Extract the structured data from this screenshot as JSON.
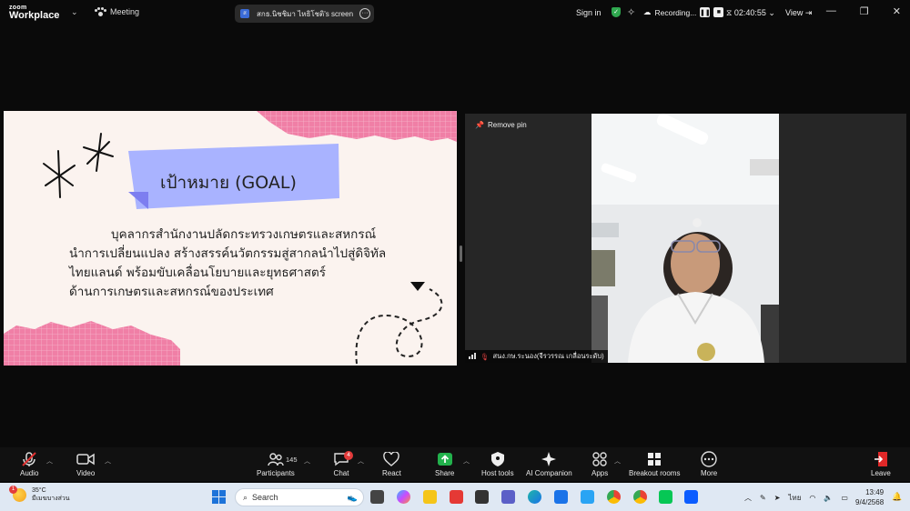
{
  "titlebar": {
    "logo_top": "zoom",
    "logo_bottom": "Workplace",
    "meeting_label": "Meeting",
    "share_pill_badge": "ส",
    "share_pill_text": "สกธ.นิชชิมา  ไหธิโชติ's screen",
    "signin": "Sign in",
    "recording": "Recording...",
    "timer": "02:40:55",
    "view": "View"
  },
  "slide": {
    "title": "เป้าหมาย (GOAL)",
    "body_lines": [
      "บุคลากรสำนักงานปลัดกระทรวงเกษตรและสหกรณ์",
      "นำการเปลี่ยนแปลง สร้างสรรค์นวัตกรรมสู่สากลนำไปสู่ดิจิทัล",
      "ไทยแลนด์ พร้อมขับเคลื่อนโยบายและยุทธศาสตร์",
      "ด้านการเกษตรและสหกรณ์ของประเทศ"
    ]
  },
  "video": {
    "remove_pin": "Remove pin",
    "participant_name": "สนง.กษ.ระนอง(จีรวรรณ เกลื่อนระดับ)"
  },
  "toolbar": {
    "audio": "Audio",
    "video": "Video",
    "participants": "Participants",
    "participants_count": "145",
    "chat": "Chat",
    "chat_badge": "4",
    "react": "React",
    "share": "Share",
    "host_tools": "Host tools",
    "ai_companion": "AI Companion",
    "apps": "Apps",
    "breakout_rooms": "Breakout rooms",
    "more": "More",
    "leave": "Leave"
  },
  "taskbar": {
    "weather_badge": "1",
    "temperature": "35°C",
    "weather_desc": "มีเมฆบางส่วน",
    "search_placeholder": "Search",
    "lang": "ไทย",
    "time": "13:49",
    "date": "9/4/2568"
  },
  "colors": {
    "zoom_blue": "#0b5cff",
    "share_green": "#22b14c",
    "leave_red": "#e02828",
    "slide_pink": "#f080a8",
    "slide_tape": "#a9b4ff"
  }
}
